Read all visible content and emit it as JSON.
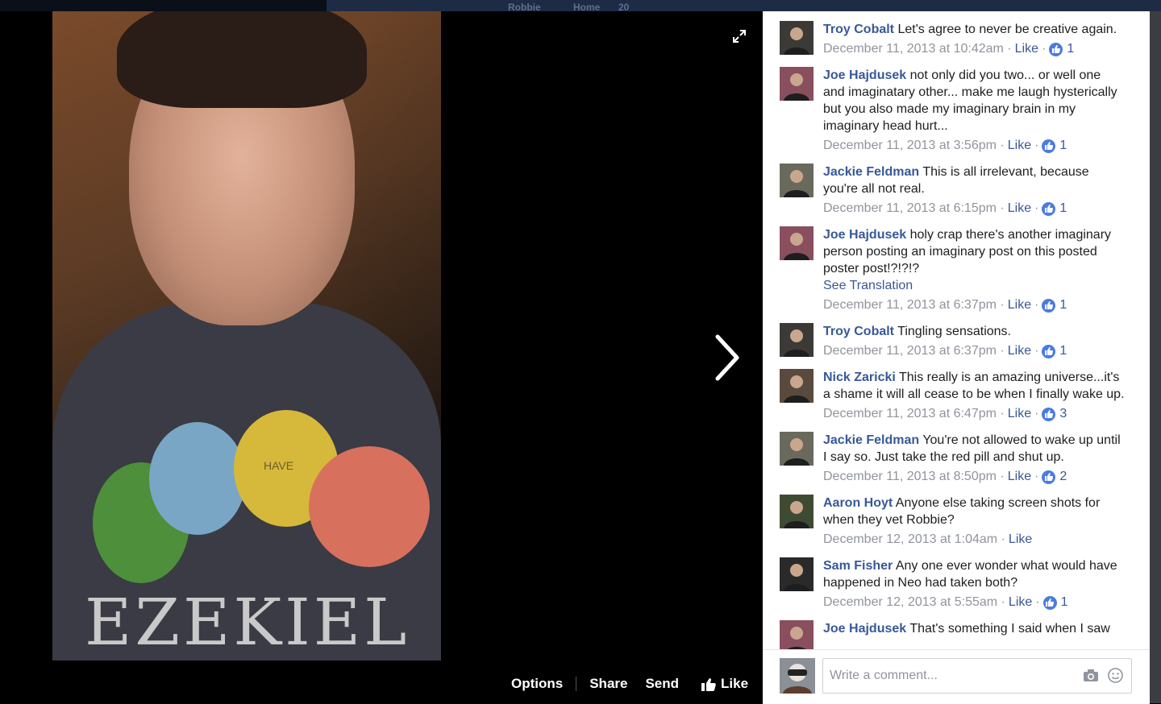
{
  "topbar": {
    "ghost_user": "Robbie",
    "ghost_home": "Home",
    "ghost_count": "20"
  },
  "photo": {
    "shirt_text": "EZEKIEL",
    "shirt_small": "HAVE"
  },
  "actions": {
    "options": "Options",
    "share": "Share",
    "send": "Send",
    "like": "Like"
  },
  "comments": [
    {
      "name": "Troy Cobalt",
      "text": "Let's agree to never be creative again.",
      "time": "December 11, 2013 at 10:42am",
      "like": "Like",
      "reactions": "1",
      "avatar_color": "#3b3a36"
    },
    {
      "name": "Joe Hajdusek",
      "text": "not only did you two... or well one and imaginatary other... make me laugh hysterically but you also made my imaginary brain in my imaginary head hurt...",
      "time": "December 11, 2013 at 3:56pm",
      "like": "Like",
      "reactions": "1",
      "avatar_color": "#8a4f5e"
    },
    {
      "name": "Jackie Feldman",
      "text": "This is all irrelevant, because you're all not real.",
      "time": "December 11, 2013 at 6:15pm",
      "like": "Like",
      "reactions": "1",
      "avatar_color": "#6a6a5c"
    },
    {
      "name": "Joe Hajdusek",
      "text": "holy crap there's another imaginary person posting an imaginary post on this posted poster post!?!?!?",
      "translation": "See Translation",
      "time": "December 11, 2013 at 6:37pm",
      "like": "Like",
      "reactions": "1",
      "avatar_color": "#8a4f5e"
    },
    {
      "name": "Troy Cobalt",
      "text": "Tingling sensations.",
      "time": "December 11, 2013 at 6:37pm",
      "like": "Like",
      "reactions": "1",
      "avatar_color": "#3b3a36"
    },
    {
      "name": "Nick Zaricki",
      "text": "This really is an amazing universe...it's a shame it will all cease to be when I finally wake up.",
      "time": "December 11, 2013 at 6:47pm",
      "like": "Like",
      "reactions": "3",
      "avatar_color": "#5a4a3e"
    },
    {
      "name": "Jackie Feldman",
      "text": "You're not allowed to wake up until I say so. Just take the red pill and shut up.",
      "time": "December 11, 2013 at 8:50pm",
      "like": "Like",
      "reactions": "2",
      "avatar_color": "#6a6a5c"
    },
    {
      "name": "Aaron Hoyt",
      "text": "Anyone else taking screen shots for when they vet Robbie?",
      "time": "December 12, 2013 at 1:04am",
      "like": "Like",
      "reactions": "",
      "avatar_color": "#3f4a33"
    },
    {
      "name": "Sam Fisher",
      "text": "Any one ever wonder what would have happened in Neo had taken both?",
      "time": "December 12, 2013 at 5:55am",
      "like": "Like",
      "reactions": "1",
      "avatar_color": "#2a2a2a"
    },
    {
      "name": "Joe Hajdusek",
      "text": "That's something I said when I saw",
      "time": "",
      "like": "",
      "reactions": "",
      "avatar_color": "#8a4f5e"
    }
  ],
  "composer": {
    "placeholder": "Write a comment..."
  }
}
